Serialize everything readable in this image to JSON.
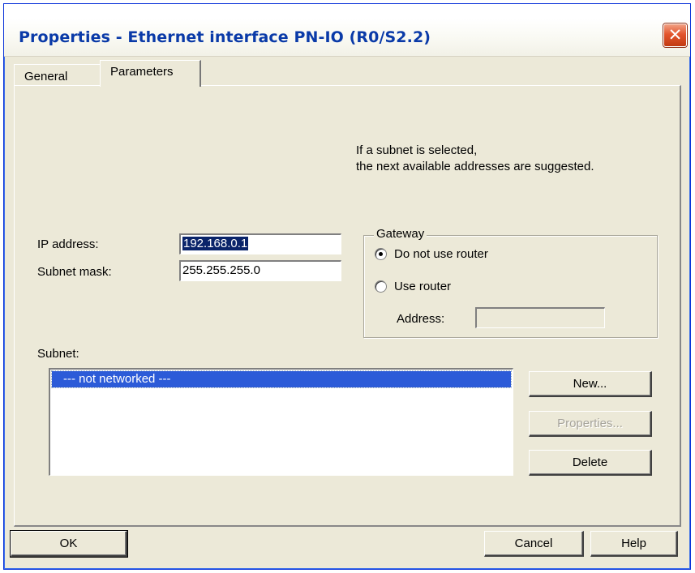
{
  "window": {
    "title": "Properties - Ethernet interface  PN-IO (R0/S2.2)"
  },
  "tabs": [
    {
      "label": "General",
      "active": false
    },
    {
      "label": "Parameters",
      "active": true
    }
  ],
  "hint": {
    "line1": "If a subnet is selected,",
    "line2": "the next available addresses are suggested."
  },
  "ip": {
    "label": "IP address:",
    "value": "192.168.0.1"
  },
  "mask": {
    "label": "Subnet mask:",
    "value": "255.255.255.0"
  },
  "gateway": {
    "legend": "Gateway",
    "option1": "Do not use router",
    "option2": "Use router",
    "selected": "Do not use router",
    "address_label": "Address:",
    "address_value": ""
  },
  "subnet": {
    "label": "Subnet:",
    "items": [
      "--- not networked ---"
    ],
    "selected": "--- not networked ---"
  },
  "buttons": {
    "new": "New...",
    "properties": "Properties...",
    "delete": "Delete",
    "ok": "OK",
    "cancel": "Cancel",
    "help": "Help"
  },
  "colors": {
    "title": "#0a3aa8",
    "selection": "#2c5bd8",
    "close": "#e3552d"
  }
}
